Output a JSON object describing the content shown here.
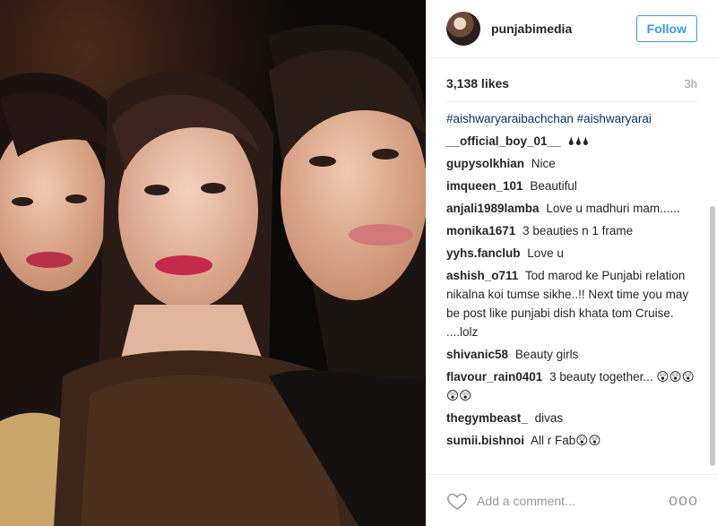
{
  "post": {
    "username": "punjabimedia",
    "follow_label": "Follow",
    "likes": "3,138 likes",
    "time": "3h",
    "hashtags": "#aishwaryaraibachchan #aishwaryarai",
    "comments": [
      {
        "user": "__official_boy_01__",
        "text": "🌢🌢🌢"
      },
      {
        "user": "gupysolkhian",
        "text": "Nice"
      },
      {
        "user": "imqueen_101",
        "text": "Beautiful"
      },
      {
        "user": "anjali1989lamba",
        "text": "Love u madhuri mam......"
      },
      {
        "user": "monika1671",
        "text": "3 beauties n 1 frame"
      },
      {
        "user": "yyhs.fanclub",
        "text": "Love u"
      },
      {
        "user": "ashish_o711",
        "text": "Tod marod ke Punjabi relation nikalna koi tumse sikhe..!! Next time you may be post like punjabi dish khata tom Cruise. ....lolz"
      },
      {
        "user": "shivanic58",
        "text": "Beauty girls"
      },
      {
        "user": "flavour_rain0401",
        "text": "3 beauty together... 😲😲😲😲😲"
      },
      {
        "user": "thegymbeast_",
        "text": "divas"
      },
      {
        "user": "sumii.bishnoi",
        "text": "All r Fab😲😲"
      }
    ],
    "add_comment_placeholder": "Add a comment...",
    "more_options": "ooo",
    "icons": {
      "heart": "heart-icon",
      "more": "more-options-icon"
    }
  }
}
